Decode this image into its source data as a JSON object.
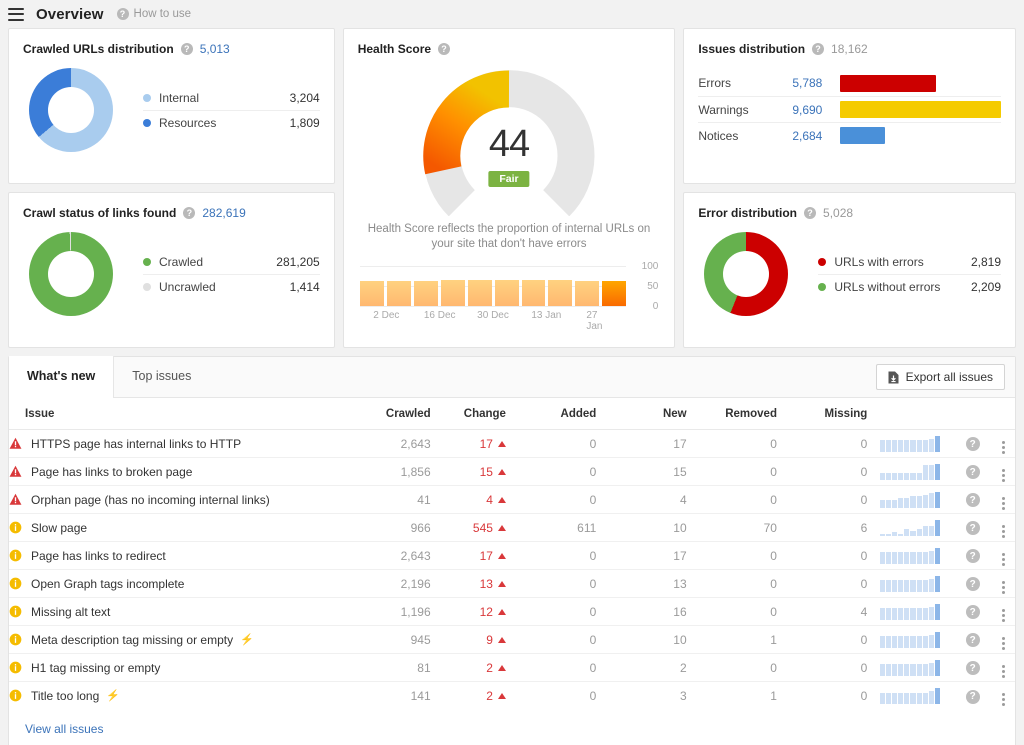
{
  "header": {
    "menu_icon": "hamburger-icon",
    "title": "Overview",
    "help_label": "How to use"
  },
  "crawled_urls": {
    "title": "Crawled URLs distribution",
    "total": "5,013",
    "legend": [
      {
        "label": "Internal",
        "value": "3,204",
        "color": "#a9ccee"
      },
      {
        "label": "Resources",
        "value": "1,809",
        "color": "#3b7dd8"
      }
    ]
  },
  "crawl_status": {
    "title": "Crawl status of links found",
    "total": "282,619",
    "legend": [
      {
        "label": "Crawled",
        "value": "281,205",
        "color": "#66b14e"
      },
      {
        "label": "Uncrawled",
        "value": "1,414",
        "color": "#e0e0e0"
      }
    ]
  },
  "health_score": {
    "title": "Health Score",
    "score": "44",
    "badge": "Fair",
    "description": "Health Score reflects the proportion of internal URLs on your site that don't have errors",
    "y_labels": [
      "100",
      "50",
      "0"
    ],
    "x_labels": [
      "2 Dec",
      "16 Dec",
      "30 Dec",
      "13 Jan",
      "27 Jan"
    ]
  },
  "issues_distribution": {
    "title": "Issues distribution",
    "total": "18,162",
    "rows": [
      {
        "label": "Errors",
        "value": "5,788",
        "color": "#cc0000"
      },
      {
        "label": "Warnings",
        "value": "9,690",
        "color": "#f5cb00"
      },
      {
        "label": "Notices",
        "value": "2,684",
        "color": "#4a90d9"
      }
    ]
  },
  "error_distribution": {
    "title": "Error distribution",
    "total": "5,028",
    "legend": [
      {
        "label": "URLs with errors",
        "value": "2,819",
        "color": "#cc0000"
      },
      {
        "label": "URLs without errors",
        "value": "2,209",
        "color": "#66b14e"
      }
    ]
  },
  "issues_panel": {
    "tabs": [
      {
        "label": "What's new",
        "active": true
      },
      {
        "label": "Top issues",
        "active": false
      }
    ],
    "export_label": "Export all issues",
    "columns": [
      "Issue",
      "Crawled",
      "Change",
      "Added",
      "New",
      "Removed",
      "Missing"
    ],
    "view_all_label": "View all issues",
    "rows": [
      {
        "severity": "error",
        "issue": "HTTPS page has internal links to HTTP",
        "bolt": false,
        "crawled": "2,643",
        "change": "17",
        "added": "0",
        "new": "17",
        "removed": "0",
        "missing": "0"
      },
      {
        "severity": "error",
        "issue": "Page has links to broken page",
        "bolt": false,
        "crawled": "1,856",
        "change": "15",
        "added": "0",
        "new": "15",
        "removed": "0",
        "missing": "0"
      },
      {
        "severity": "error",
        "issue": "Orphan page (has no incoming internal links)",
        "bolt": false,
        "crawled": "41",
        "change": "4",
        "added": "0",
        "new": "4",
        "removed": "0",
        "missing": "0"
      },
      {
        "severity": "warning",
        "issue": "Slow page",
        "bolt": false,
        "crawled": "966",
        "change": "545",
        "added": "611",
        "new": "10",
        "removed": "70",
        "missing": "6"
      },
      {
        "severity": "warning",
        "issue": "Page has links to redirect",
        "bolt": false,
        "crawled": "2,643",
        "change": "17",
        "added": "0",
        "new": "17",
        "removed": "0",
        "missing": "0"
      },
      {
        "severity": "warning",
        "issue": "Open Graph tags incomplete",
        "bolt": false,
        "crawled": "2,196",
        "change": "13",
        "added": "0",
        "new": "13",
        "removed": "0",
        "missing": "0"
      },
      {
        "severity": "warning",
        "issue": "Missing alt text",
        "bolt": false,
        "crawled": "1,196",
        "change": "12",
        "added": "0",
        "new": "16",
        "removed": "0",
        "missing": "4"
      },
      {
        "severity": "warning",
        "issue": "Meta description tag missing or empty",
        "bolt": true,
        "crawled": "945",
        "change": "9",
        "added": "0",
        "new": "10",
        "removed": "1",
        "missing": "0"
      },
      {
        "severity": "warning",
        "issue": "H1 tag missing or empty",
        "bolt": false,
        "crawled": "81",
        "change": "2",
        "added": "0",
        "new": "2",
        "removed": "0",
        "missing": "0"
      },
      {
        "severity": "warning",
        "issue": "Title too long",
        "bolt": true,
        "crawled": "141",
        "change": "2",
        "added": "0",
        "new": "3",
        "removed": "1",
        "missing": "0"
      }
    ]
  },
  "chart_data": [
    {
      "type": "pie",
      "title": "Crawled URLs distribution",
      "labels": [
        "Internal",
        "Resources"
      ],
      "values": [
        3204,
        1809
      ],
      "colors": [
        "#a9ccee",
        "#3b7dd8"
      ],
      "total": 5013,
      "legend": "right"
    },
    {
      "type": "pie",
      "title": "Crawl status of links found",
      "labels": [
        "Crawled",
        "Uncrawled"
      ],
      "values": [
        281205,
        1414
      ],
      "colors": [
        "#66b14e",
        "#e0e0e0"
      ],
      "total": 282619,
      "legend": "right"
    },
    {
      "type": "bar",
      "title": "Health Score",
      "categories": [
        "2 Dec",
        "",
        "16 Dec",
        "",
        "30 Dec",
        "",
        "13 Jan",
        "",
        "27 Jan",
        ""
      ],
      "values": [
        45,
        45,
        45,
        46,
        47,
        46,
        46,
        46,
        45,
        44
      ],
      "ylabel": "",
      "ylim": [
        0,
        100
      ],
      "yticks": [
        0,
        50,
        100
      ],
      "grid": true,
      "annotations": [
        "44",
        "Fair"
      ]
    },
    {
      "type": "bar",
      "title": "Issues distribution",
      "categories": [
        "Errors",
        "Warnings",
        "Notices"
      ],
      "values": [
        5788,
        9690,
        2684
      ],
      "colors": [
        "#cc0000",
        "#f5cb00",
        "#4a90d9"
      ],
      "total": 18162,
      "orientation": "horizontal",
      "xlim": [
        0,
        9690
      ]
    },
    {
      "type": "pie",
      "title": "Error distribution",
      "labels": [
        "URLs with errors",
        "URLs without errors"
      ],
      "values": [
        2819,
        2209
      ],
      "colors": [
        "#cc0000",
        "#66b14e"
      ],
      "total": 5028,
      "legend": "right"
    }
  ],
  "sparklines": [
    [
      7,
      7,
      7,
      7,
      7,
      7,
      7,
      7,
      8,
      10
    ],
    [
      4,
      4,
      4,
      4,
      4,
      4,
      4,
      9,
      9,
      10
    ],
    [
      5,
      5,
      5,
      6,
      6,
      7,
      7,
      8,
      9,
      10
    ],
    [
      1,
      1,
      2,
      1,
      4,
      3,
      4,
      6,
      6,
      10
    ],
    [
      7,
      7,
      7,
      7,
      7,
      7,
      7,
      7,
      8,
      10
    ],
    [
      7,
      7,
      7,
      7,
      7,
      7,
      7,
      7,
      8,
      10
    ],
    [
      7,
      7,
      7,
      7,
      7,
      7,
      7,
      7,
      8,
      10
    ],
    [
      7,
      7,
      7,
      7,
      7,
      7,
      7,
      7,
      8,
      10
    ],
    [
      7,
      7,
      7,
      7,
      7,
      7,
      7,
      7,
      8,
      10
    ],
    [
      7,
      7,
      7,
      7,
      7,
      7,
      7,
      7,
      8,
      10
    ]
  ]
}
